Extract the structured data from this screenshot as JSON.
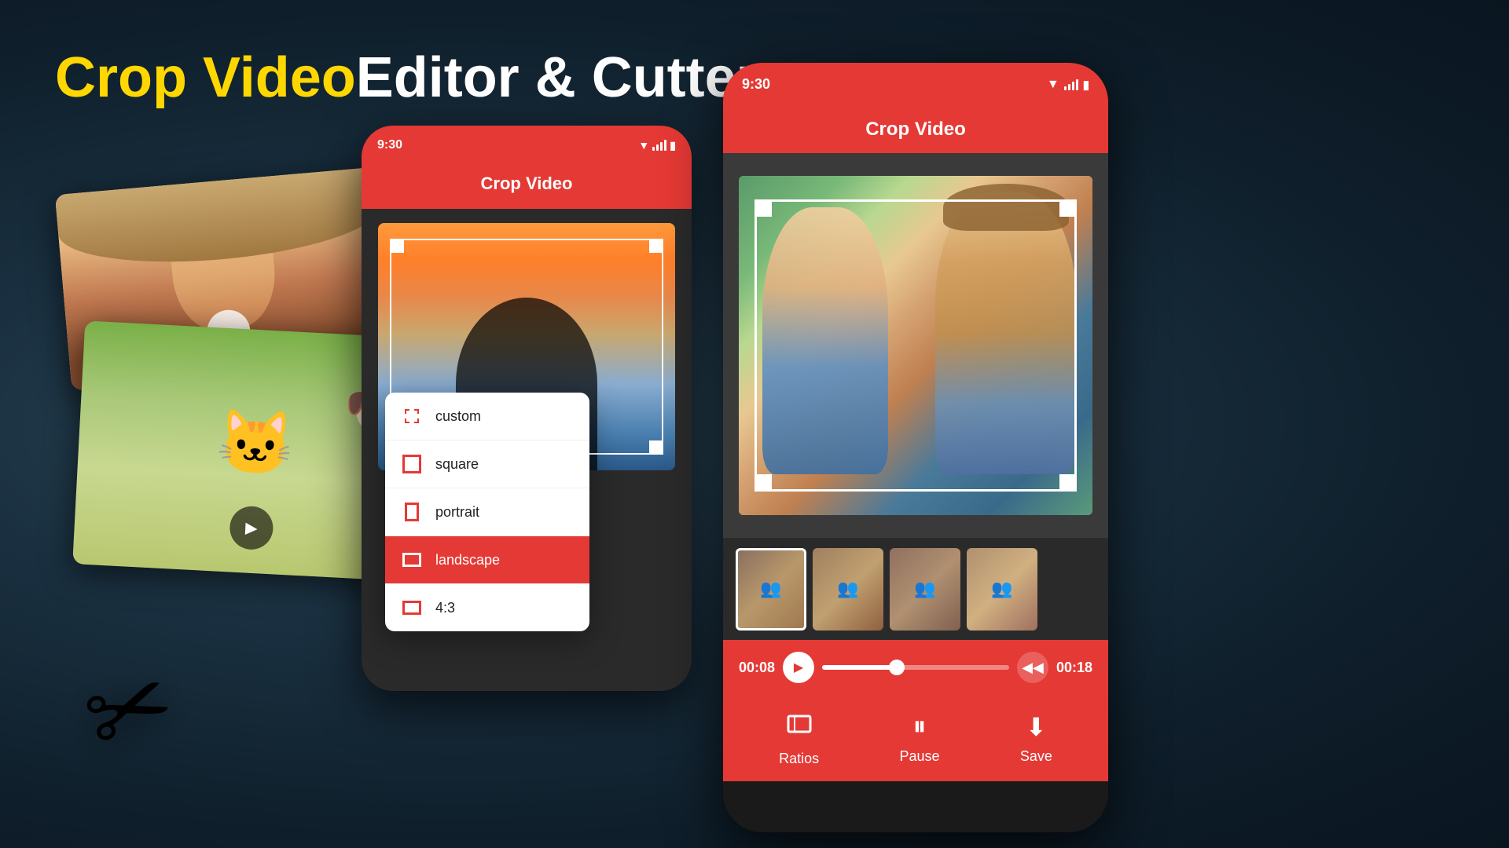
{
  "page": {
    "title_yellow": "Crop Video",
    "title_separator": " - ",
    "title_white": "Editor & Cutter",
    "background": "#1a2530"
  },
  "left_panel": {
    "pause_icon": "⏸",
    "play_icon": "▶",
    "scissors_icon": "✂",
    "cat_icon": "🐱🐶"
  },
  "middle_phone": {
    "status_time": "9:30",
    "app_title": "Crop Video",
    "dropdown": {
      "items": [
        {
          "label": "custom",
          "active": false,
          "icon_type": "custom"
        },
        {
          "label": "square",
          "active": false,
          "icon_type": "square"
        },
        {
          "label": "portrait",
          "active": false,
          "icon_type": "portrait"
        },
        {
          "label": "landscape",
          "active": true,
          "icon_type": "landscape"
        },
        {
          "label": "4:3",
          "active": false,
          "icon_type": "ratio43"
        }
      ]
    }
  },
  "right_phone": {
    "status_time": "9:30",
    "app_title": "Crop Video",
    "time_start": "00:08",
    "time_end": "00:18",
    "toolbar": {
      "ratios_label": "Ratios",
      "pause_label": "Pause",
      "save_label": "Save"
    }
  }
}
